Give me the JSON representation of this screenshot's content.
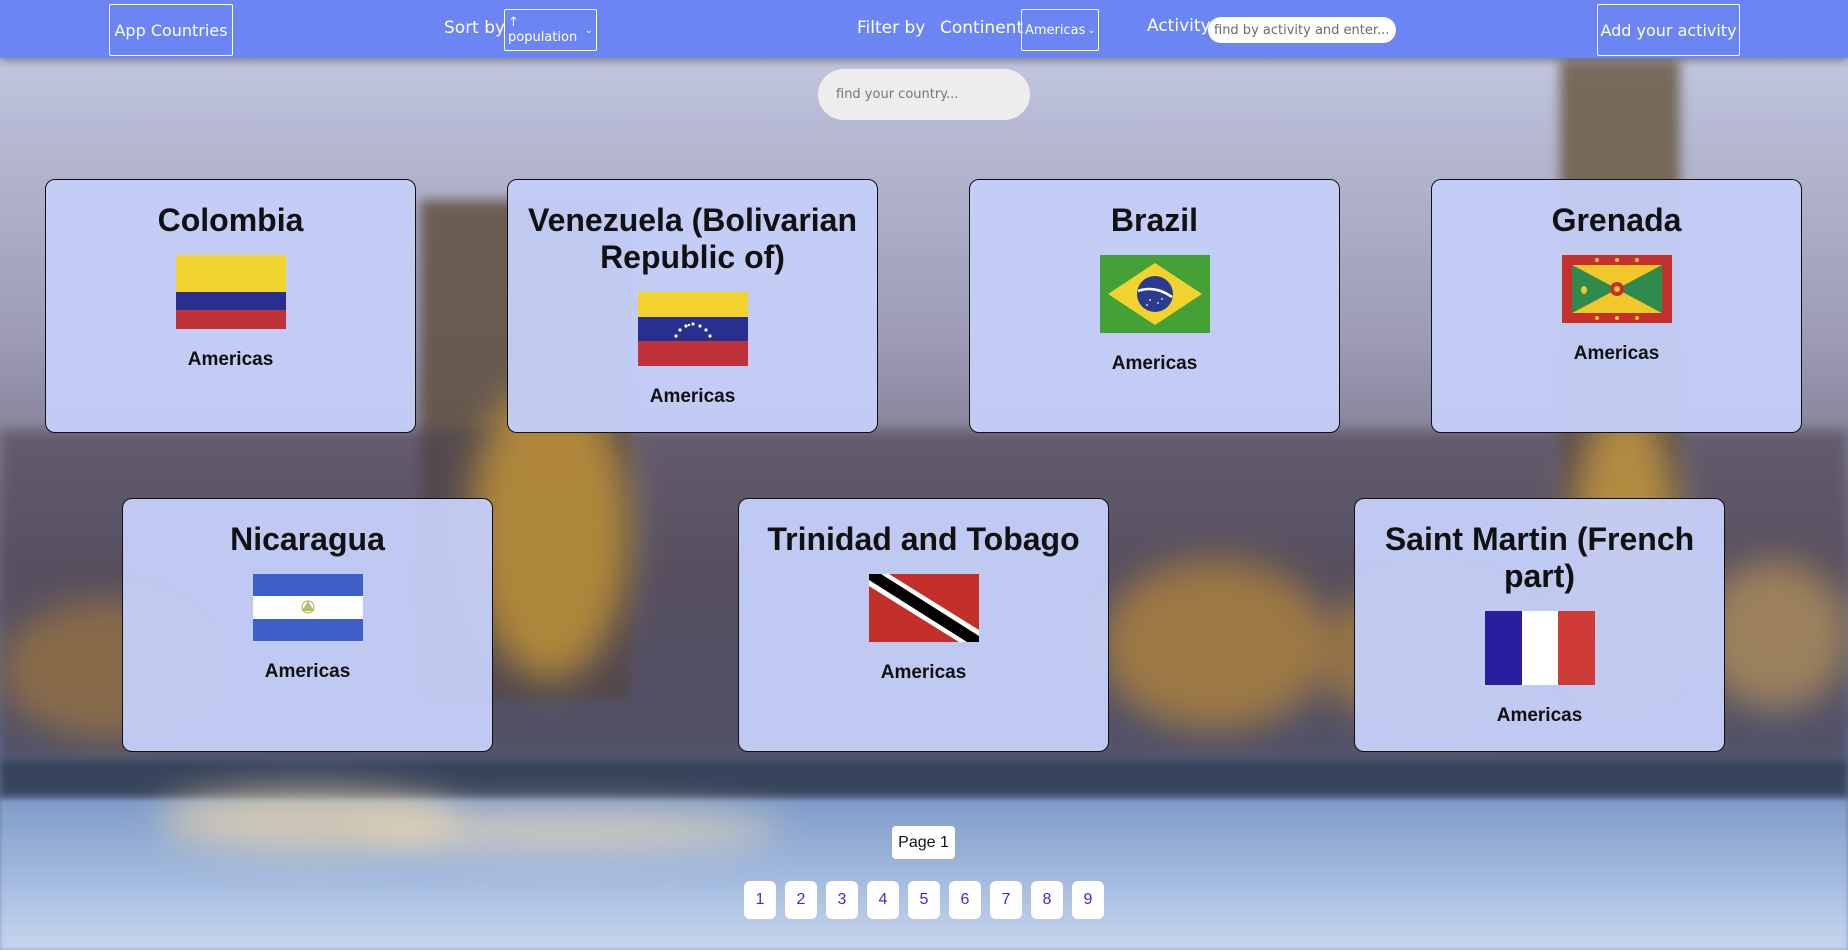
{
  "header": {
    "app_button": "App Countries",
    "sort_label": "Sort by",
    "sort_value": "↑ population",
    "filter_label": "Filter by",
    "continent_label": "Continent",
    "continent_value": "Americas",
    "activity_label": "Activity",
    "activity_placeholder": "find by activity and enter...",
    "add_button": "Add your activity"
  },
  "search": {
    "placeholder": "find your country..."
  },
  "cards": [
    {
      "name": "Colombia",
      "continent": "Americas",
      "flag": "colombia-flag-icon"
    },
    {
      "name": "Venezuela (Bolivarian Republic of)",
      "continent": "Americas",
      "flag": "venezuela-flag-icon"
    },
    {
      "name": "Brazil",
      "continent": "Americas",
      "flag": "brazil-flag-icon"
    },
    {
      "name": "Grenada",
      "continent": "Americas",
      "flag": "grenada-flag-icon"
    },
    {
      "name": "Nicaragua",
      "continent": "Americas",
      "flag": "nicaragua-flag-icon"
    },
    {
      "name": "Trinidad and Tobago",
      "continent": "Americas",
      "flag": "trinidad-tobago-flag-icon"
    },
    {
      "name": "Saint Martin (French part)",
      "continent": "Americas",
      "flag": "france-flag-icon"
    }
  ],
  "pagination": {
    "current_label": "Page 1",
    "pages": [
      "1",
      "2",
      "3",
      "4",
      "5",
      "6",
      "7",
      "8",
      "9"
    ]
  },
  "colors": {
    "header": "#6b86f2",
    "card": "#c4cef7",
    "page_link": "#3a2dd6"
  }
}
